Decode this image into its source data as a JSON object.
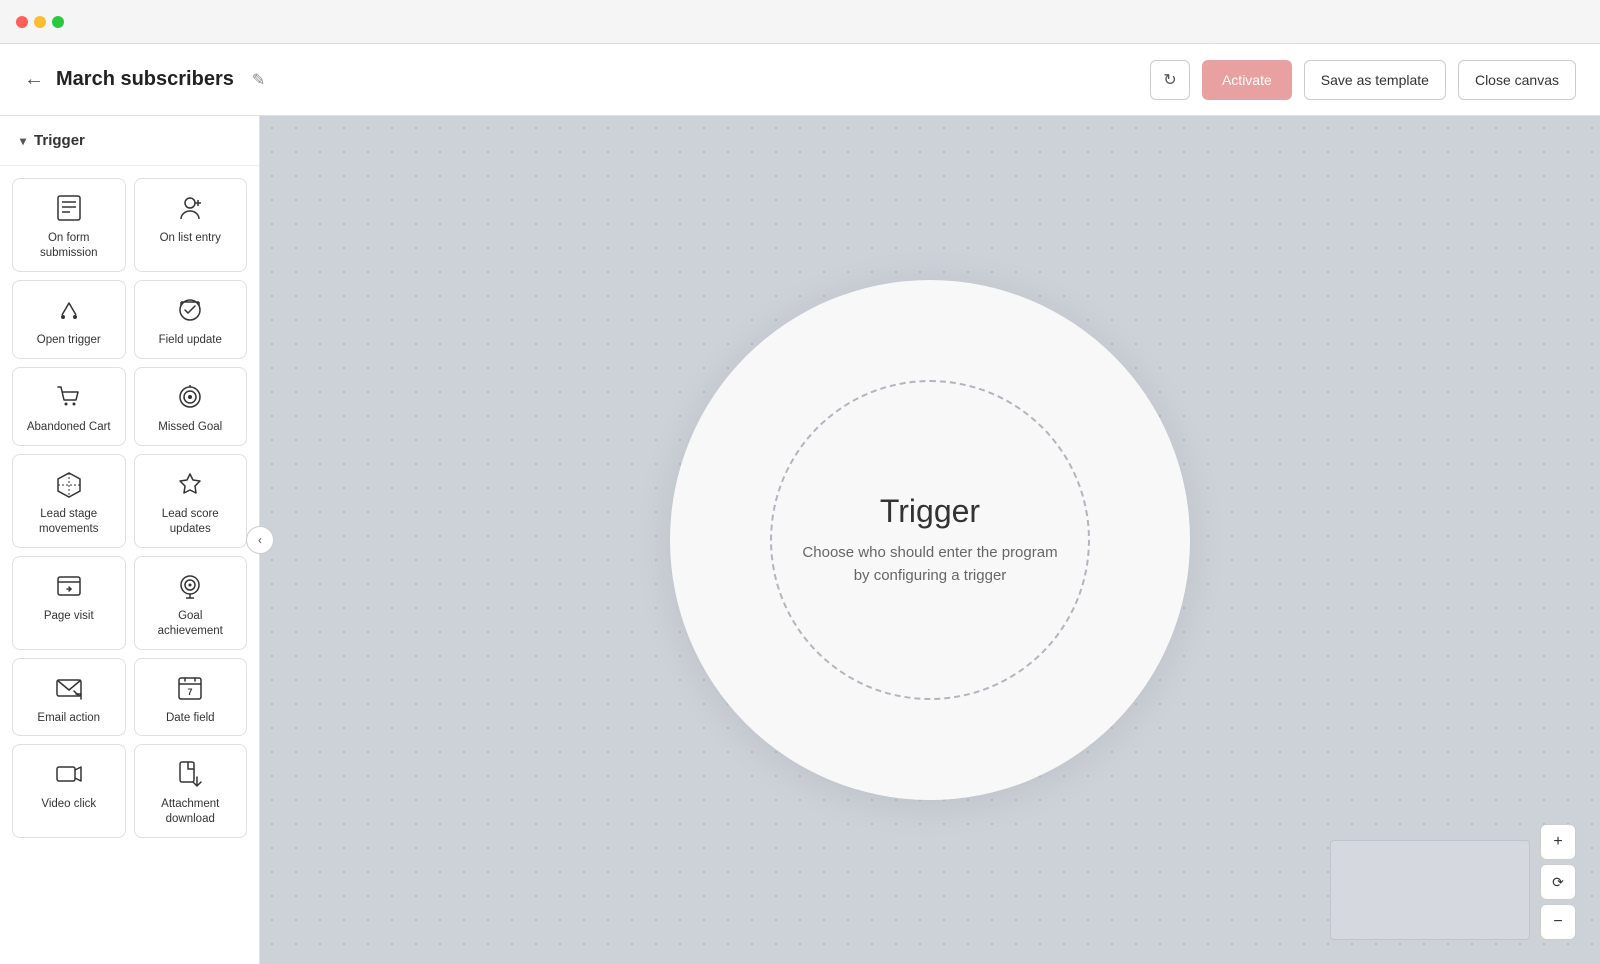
{
  "titlebar": {
    "dots": [
      "red",
      "yellow",
      "green"
    ]
  },
  "topbar": {
    "title": "March subscribers",
    "back_icon": "←",
    "edit_icon": "✎",
    "refresh_icon": "↻",
    "activate_label": "Activate",
    "save_template_label": "Save as template",
    "close_canvas_label": "Close canvas"
  },
  "sidebar": {
    "header": "Trigger",
    "chevron": "▾",
    "items": [
      {
        "id": "on-form-submission",
        "label": "On form submission",
        "icon": "form"
      },
      {
        "id": "on-list-entry",
        "label": "On list entry",
        "icon": "list-entry"
      },
      {
        "id": "open-trigger",
        "label": "Open trigger",
        "icon": "open-trigger"
      },
      {
        "id": "field-update",
        "label": "Field update",
        "icon": "field-update"
      },
      {
        "id": "abandoned-cart",
        "label": "Abandoned Cart",
        "icon": "cart"
      },
      {
        "id": "missed-goal",
        "label": "Missed Goal",
        "icon": "missed-goal"
      },
      {
        "id": "lead-stage-movements",
        "label": "Lead stage movements",
        "icon": "lead-stage"
      },
      {
        "id": "lead-score-updates",
        "label": "Lead score updates",
        "icon": "lead-score"
      },
      {
        "id": "page-visit",
        "label": "Page visit",
        "icon": "page-visit"
      },
      {
        "id": "goal-achievement",
        "label": "Goal achievement",
        "icon": "goal-achievement"
      },
      {
        "id": "email-action",
        "label": "Email action",
        "icon": "email-action"
      },
      {
        "id": "date-field",
        "label": "Date field",
        "icon": "date-field"
      },
      {
        "id": "video-click",
        "label": "Video click",
        "icon": "video-click"
      },
      {
        "id": "attachment-download",
        "label": "Attachment download",
        "icon": "attachment-download"
      }
    ]
  },
  "canvas": {
    "trigger_title": "Trigger",
    "trigger_description": "Choose who should enter the program by configuring a trigger"
  },
  "zoom_controls": {
    "zoom_in": "+",
    "zoom_reset": "⟳",
    "zoom_out": "−"
  }
}
